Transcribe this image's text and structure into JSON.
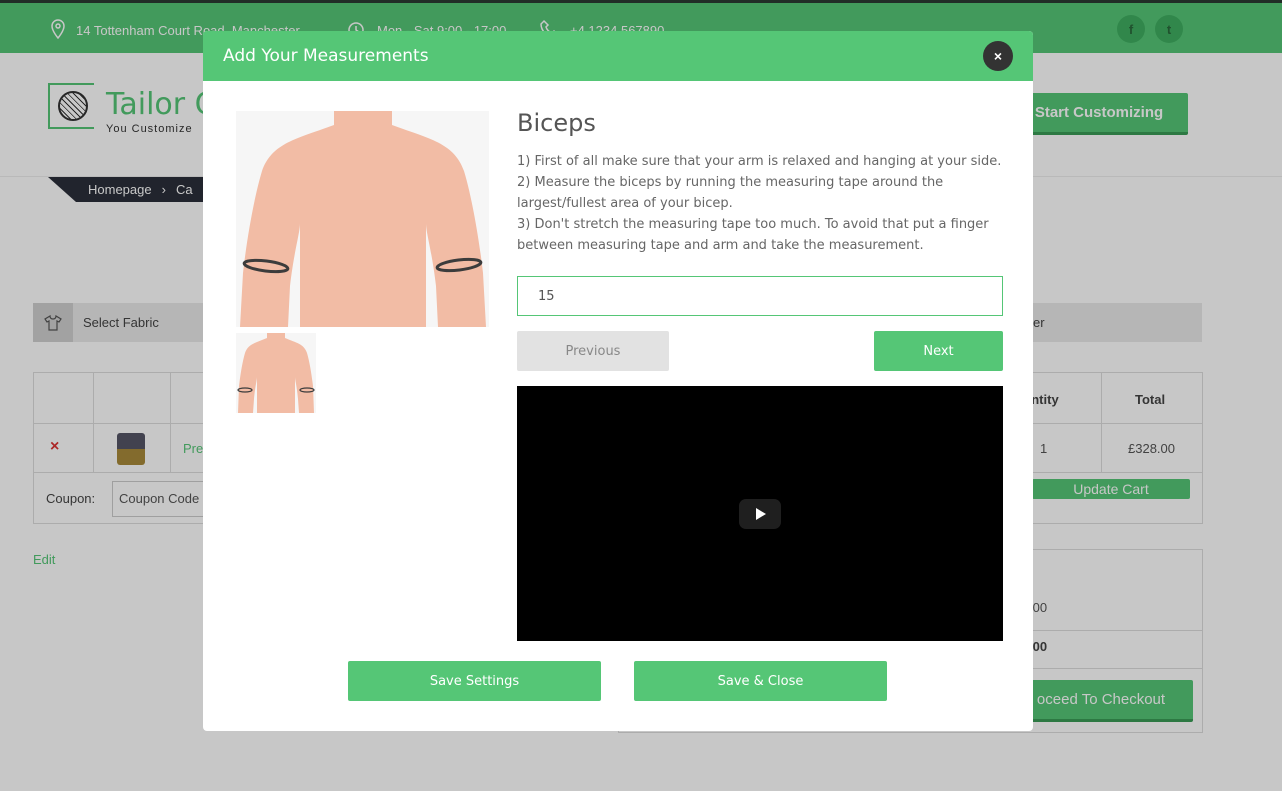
{
  "topbar": {
    "address": "14 Tottenham Court Road, Manchester",
    "hours": "Mon - Sat 9:00 - 17:00",
    "phone": "+4 1234 567890",
    "social": [
      "f",
      "t"
    ]
  },
  "header": {
    "logo_text": "Tailor C",
    "logo_tagline": "You Customize",
    "cta": "Start Customizing"
  },
  "breadcrumb": {
    "home": "Homepage",
    "separator": "›",
    "current": "Ca"
  },
  "steps": {
    "first": "Select Fabric",
    "last": "er"
  },
  "cart": {
    "headers": {
      "quantity": "antity",
      "total": "Total"
    },
    "row": {
      "remove": "×",
      "product": "Pre",
      "quantity": "1",
      "total": "£328.00"
    },
    "coupon_label": "Coupon:",
    "coupon_placeholder": "Coupon Code",
    "update_button": "Update Cart"
  },
  "edit_link": "Edit",
  "totals": {
    "subtotal": ".00",
    "total": ".00",
    "checkout_button": "oceed To Checkout"
  },
  "modal": {
    "title": "Add Your Measurements",
    "close": "×",
    "measurement_title": "Biceps",
    "instructions": [
      "1) First of all make sure that your arm is relaxed and hanging at your side.",
      "2) Measure the biceps by running the measuring tape around the largest/fullest area of your bicep.",
      "3) Don't stretch the measuring tape too much. To avoid that put a finger between measuring tape and arm and take the measurement."
    ],
    "input_value": "15",
    "previous_button": "Previous",
    "next_button": "Next",
    "save_settings_button": "Save Settings",
    "save_close_button": "Save & Close"
  },
  "colors": {
    "accent": "#55c676",
    "dark": "#333333",
    "video_bg": "#000000"
  },
  "icons": {
    "address": "map-pin-icon",
    "hours": "alarm-clock-icon",
    "phone": "phone-icon",
    "step": "shirt-icon",
    "video": "play-icon"
  }
}
